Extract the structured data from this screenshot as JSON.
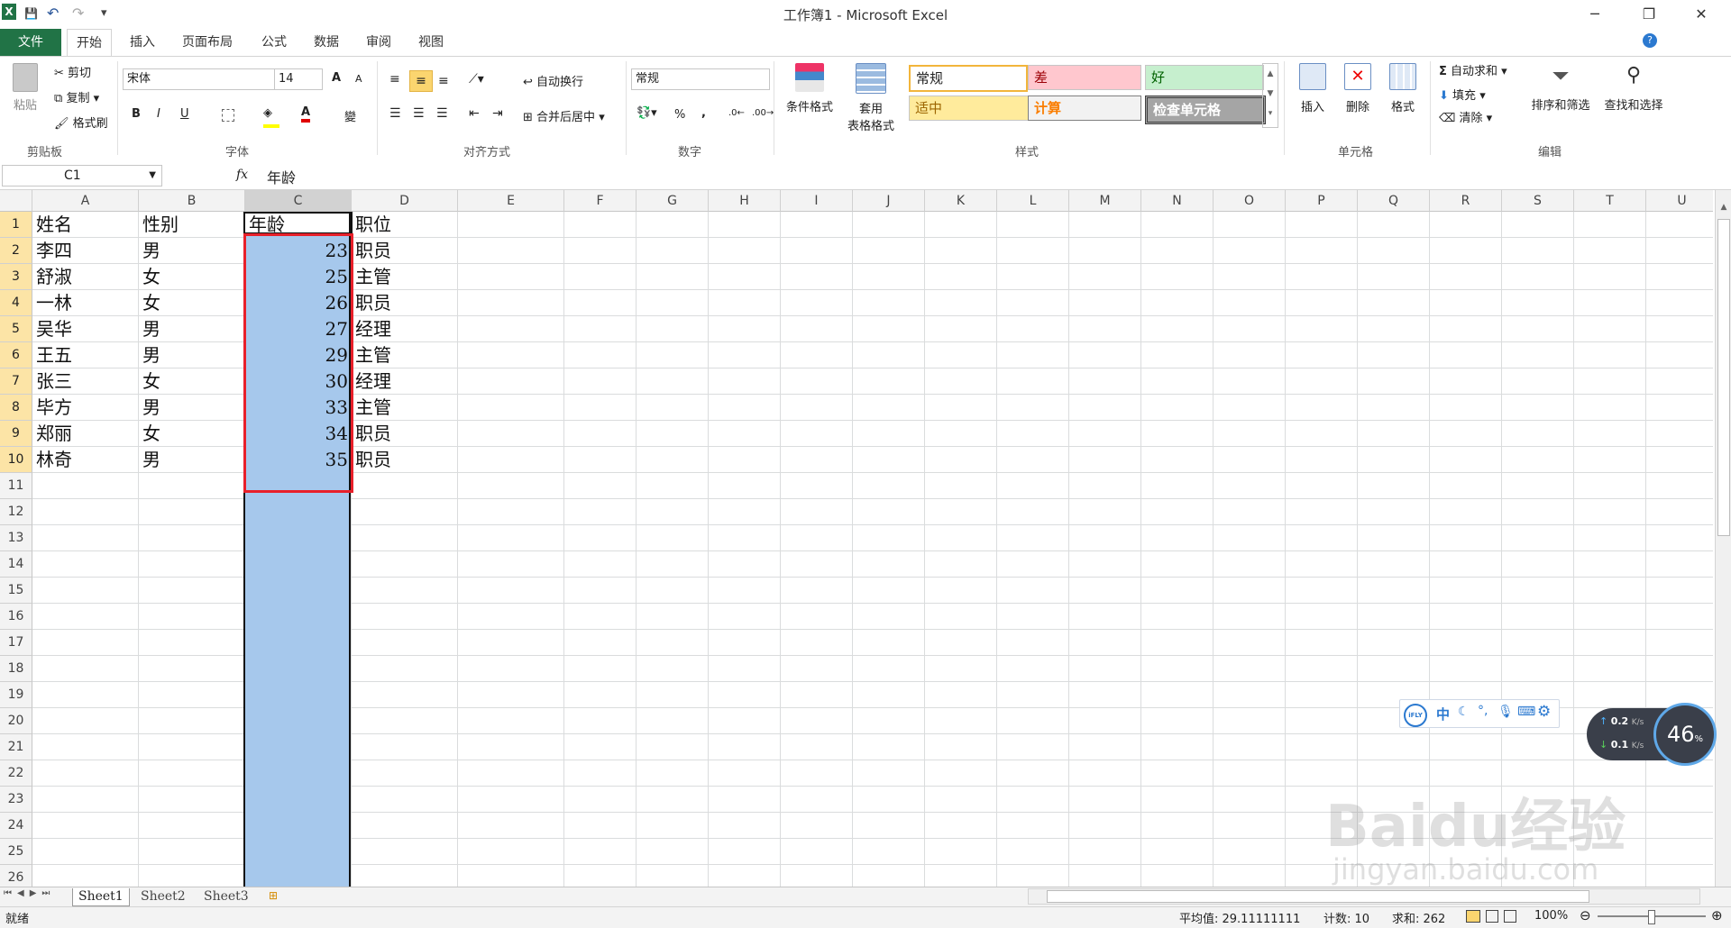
{
  "title": "工作簿1 - Microsoft Excel",
  "window": {
    "minimize": "─",
    "restore": "❐",
    "close": "✕"
  },
  "quick_access": {
    "save": "💾",
    "undo": "↶",
    "redo": "↷",
    "customize": "▾"
  },
  "tabs": {
    "file": "文件",
    "items": [
      "开始",
      "插入",
      "页面布局",
      "公式",
      "数据",
      "审阅",
      "视图"
    ]
  },
  "ribbon": {
    "clipboard": {
      "paste": "粘贴",
      "cut": "剪切",
      "copy": "复制",
      "format_painter": "格式刷",
      "label": "剪贴板"
    },
    "font": {
      "name": "宋体",
      "size": "14",
      "grow": "A",
      "shrink": "A",
      "bold": "B",
      "italic": "I",
      "underline": "U",
      "label": "字体",
      "fontcolor": "A",
      "wen": "變"
    },
    "alignment": {
      "wrap": "自动换行",
      "merge": "合并后居中",
      "label": "对齐方式"
    },
    "number": {
      "format": "常规",
      "percent": "%",
      "comma": ",",
      "label": "数字"
    },
    "styles": {
      "conditional": "条件格式",
      "table_format_1": "套用",
      "table_format_2": "表格格式",
      "normal": "常规",
      "bad": "差",
      "good": "好",
      "neutral": "适中",
      "calc": "计算",
      "check": "检查单元格",
      "label": "样式"
    },
    "cells": {
      "insert": "插入",
      "delete": "删除",
      "format": "格式",
      "label": "单元格"
    },
    "editing": {
      "autosum": "自动求和",
      "fill": "填充",
      "clear": "清除",
      "sort": "排序和筛选",
      "find": "查找和选择",
      "label": "编辑"
    }
  },
  "formula_bar": {
    "namebox": "C1",
    "fx": "fx",
    "content": "年龄"
  },
  "columns": [
    "A",
    "B",
    "C",
    "D",
    "E",
    "F",
    "G",
    "H",
    "I",
    "J",
    "K",
    "L",
    "M",
    "N",
    "O",
    "P",
    "Q",
    "R",
    "S",
    "T",
    "U"
  ],
  "rows": [
    "1",
    "2",
    "3",
    "4",
    "5",
    "6",
    "7",
    "8",
    "9",
    "10",
    "11",
    "12",
    "13",
    "14",
    "15",
    "16",
    "17",
    "18",
    "19",
    "20",
    "21",
    "22",
    "23",
    "24",
    "25",
    "26"
  ],
  "table": {
    "headers": [
      "姓名",
      "性别",
      "年龄",
      "职位"
    ],
    "rows": [
      [
        "李四",
        "男",
        "23",
        "职员"
      ],
      [
        "舒淑",
        "女",
        "25",
        "主管"
      ],
      [
        "一林",
        "女",
        "26",
        "职员"
      ],
      [
        "吴华",
        "男",
        "27",
        "经理"
      ],
      [
        "王五",
        "男",
        "29",
        "主管"
      ],
      [
        "张三",
        "女",
        "30",
        "经理"
      ],
      [
        "毕方",
        "男",
        "33",
        "主管"
      ],
      [
        "郑丽",
        "女",
        "34",
        "职员"
      ],
      [
        "林奇",
        "男",
        "35",
        "职员"
      ]
    ]
  },
  "sheets": [
    "Sheet1",
    "Sheet2",
    "Sheet3"
  ],
  "status": {
    "ready": "就绪",
    "average": "平均值: 29.11111111",
    "count": "计数: 10",
    "sum": "求和: 262",
    "zoom": "100%"
  },
  "ime_toolbar": {
    "logo": "iFLY",
    "mode": "中"
  },
  "net_widget": {
    "up": "0.2",
    "down": "0.1",
    "unit": "K/s",
    "percent": "46",
    "pct_sign": "%"
  },
  "watermark": {
    "brand": "Baidu经验",
    "url": "jingyan.baidu.com"
  },
  "colors": {
    "excel_green": "#217346",
    "selection": "#a6c8ec",
    "highlight_border": "#e8202a",
    "row_header_sel": "#fce4a6"
  }
}
